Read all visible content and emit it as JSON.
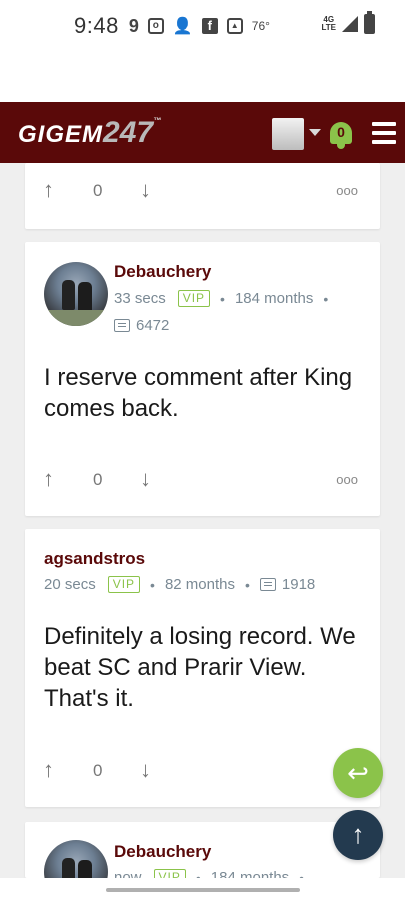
{
  "status_bar": {
    "time": "9:48",
    "temperature": "76°",
    "network": "4G LTE"
  },
  "header": {
    "logo_text": "GIGEM",
    "logo_number": "247",
    "logo_tm": "™",
    "notification_count": "0"
  },
  "posts": [
    {
      "partial": true,
      "votes": "0"
    },
    {
      "username": "Debauchery",
      "time": "33 secs",
      "badge": "VIP",
      "tenure": "184 months",
      "post_count": "6472",
      "body": "I reserve comment after King comes back.",
      "votes": "0"
    },
    {
      "username": "agsandstros",
      "time": "20 secs",
      "badge": "VIP",
      "tenure": "82 months",
      "post_count": "1918",
      "body": "Definitely a losing record. We beat SC and Prarir View. That's it.",
      "votes": "0"
    },
    {
      "username": "Debauchery",
      "time": "now",
      "badge": "VIP",
      "tenure": "184 months"
    }
  ],
  "icons": {
    "up_arrow": "↑",
    "down_arrow": "↓",
    "more": "ooo",
    "reply": "↩",
    "scroll_top": "↑"
  }
}
